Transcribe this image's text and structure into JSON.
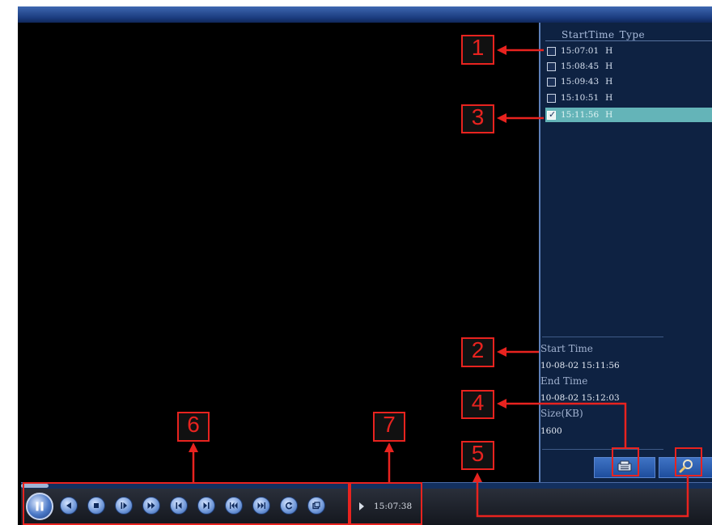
{
  "file_list": {
    "header_start_time": "StartTime",
    "header_type": "Type",
    "rows": [
      {
        "time": "15:07:01",
        "type": "H",
        "checked": false,
        "selected": false
      },
      {
        "time": "15:08:45",
        "type": "H",
        "checked": false,
        "selected": false
      },
      {
        "time": "15:09:43",
        "type": "H",
        "checked": false,
        "selected": false
      },
      {
        "time": "15:10:51",
        "type": "H",
        "checked": false,
        "selected": false
      },
      {
        "time": "15:11:56",
        "type": "H",
        "checked": true,
        "selected": true
      }
    ]
  },
  "file_info": {
    "start_time_label": "Start Time",
    "start_time_value": "10-08-02 15:11:56",
    "end_time_label": "End Time",
    "end_time_value": "10-08-02 15:12:03",
    "size_label": "Size(KB)",
    "size_value": "1600"
  },
  "panel_buttons": {
    "backup_icon": "backup-icon",
    "search_icon": "search-icon"
  },
  "playback": {
    "current_time": "15:07:38",
    "progress_fraction": 0.04,
    "controls": [
      {
        "name": "pause-button",
        "icon": "pause-icon"
      },
      {
        "name": "slow-rewind-button",
        "icon": "play-reverse-icon"
      },
      {
        "name": "stop-button",
        "icon": "stop-icon"
      },
      {
        "name": "slow-play-button",
        "icon": "slow-play-icon"
      },
      {
        "name": "fast-forward-button",
        "icon": "fast-forward-icon"
      },
      {
        "name": "previous-frame-button",
        "icon": "prev-frame-icon"
      },
      {
        "name": "next-frame-button",
        "icon": "next-frame-icon"
      },
      {
        "name": "previous-file-button",
        "icon": "prev-file-icon"
      },
      {
        "name": "next-file-button",
        "icon": "next-file-icon"
      },
      {
        "name": "repeat-button",
        "icon": "repeat-icon"
      },
      {
        "name": "fullscreen-button",
        "icon": "window-icon"
      }
    ]
  },
  "callouts": [
    "1",
    "2",
    "3",
    "4",
    "5",
    "6",
    "7"
  ],
  "colors": {
    "annotation_red": "#e8231f",
    "selected_row": "#64b4b8",
    "panel_bg": "#0e2242",
    "button_blue": "#2f5aa8"
  }
}
